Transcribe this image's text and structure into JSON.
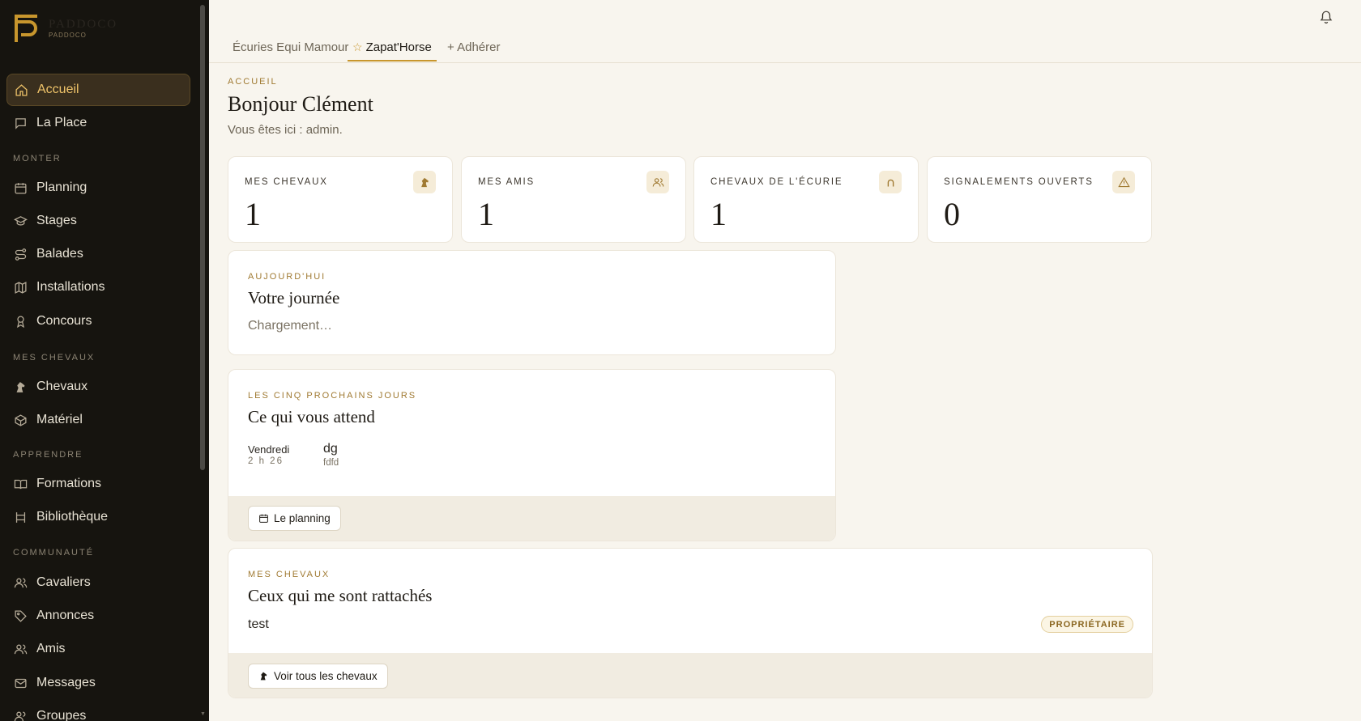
{
  "brand": {
    "name": "PADDOCO",
    "subtitle": "PADDOCO"
  },
  "sidebar": {
    "items": [
      {
        "label": "Accueil"
      },
      {
        "label": "La Place"
      },
      {
        "label": "Planning"
      },
      {
        "label": "Stages"
      },
      {
        "label": "Balades"
      },
      {
        "label": "Installations"
      },
      {
        "label": "Concours"
      },
      {
        "label": "Chevaux"
      },
      {
        "label": "Matériel"
      },
      {
        "label": "Formations"
      },
      {
        "label": "Bibliothèque"
      },
      {
        "label": "Cavaliers"
      },
      {
        "label": "Annonces"
      },
      {
        "label": "Amis"
      },
      {
        "label": "Messages"
      },
      {
        "label": "Groupes"
      }
    ],
    "sections": [
      "MONTER",
      "MES CHEVAUX",
      "APPRENDRE",
      "COMMUNAUTÉ"
    ]
  },
  "tabs": [
    {
      "label": "Écuries Equi Mamour"
    },
    {
      "label": "Zapat'Horse"
    },
    {
      "label": "+ Adhérer"
    }
  ],
  "header": {
    "eyebrow": "ACCUEIL",
    "title": "Bonjour Clément",
    "subtitle": "Vous êtes ici : admin."
  },
  "stats": [
    {
      "label": "MES CHEVAUX",
      "value": "1",
      "icon": "horse-icon"
    },
    {
      "label": "MES AMIS",
      "value": "1",
      "icon": "users-icon"
    },
    {
      "label": "CHEVAUX DE L'ÉCURIE",
      "value": "1",
      "icon": "horseshoe-icon"
    },
    {
      "label": "SIGNALEMENTS OUVERTS",
      "value": "0",
      "icon": "warning-icon"
    }
  ],
  "today": {
    "eyebrow": "AUJOURD'HUI",
    "title": "Votre journée",
    "loading": "Chargement…"
  },
  "upcoming": {
    "eyebrow": "LES CINQ PROCHAINS JOURS",
    "title": "Ce qui vous attend",
    "event": {
      "day": "Vendredi",
      "time": "2 h 26",
      "title": "dg",
      "subtitle": "fdfd"
    },
    "button": "Le planning"
  },
  "horses": {
    "eyebrow": "MES CHEVAUX",
    "title": "Ceux qui me sont rattachés",
    "horse_name": "test",
    "role": "PROPRIÉTAIRE",
    "button": "Voir tous les chevaux"
  },
  "colors": {
    "accent": "#c8962d",
    "sidebar_bg": "#16140f",
    "page_bg": "#f8f5ee"
  }
}
